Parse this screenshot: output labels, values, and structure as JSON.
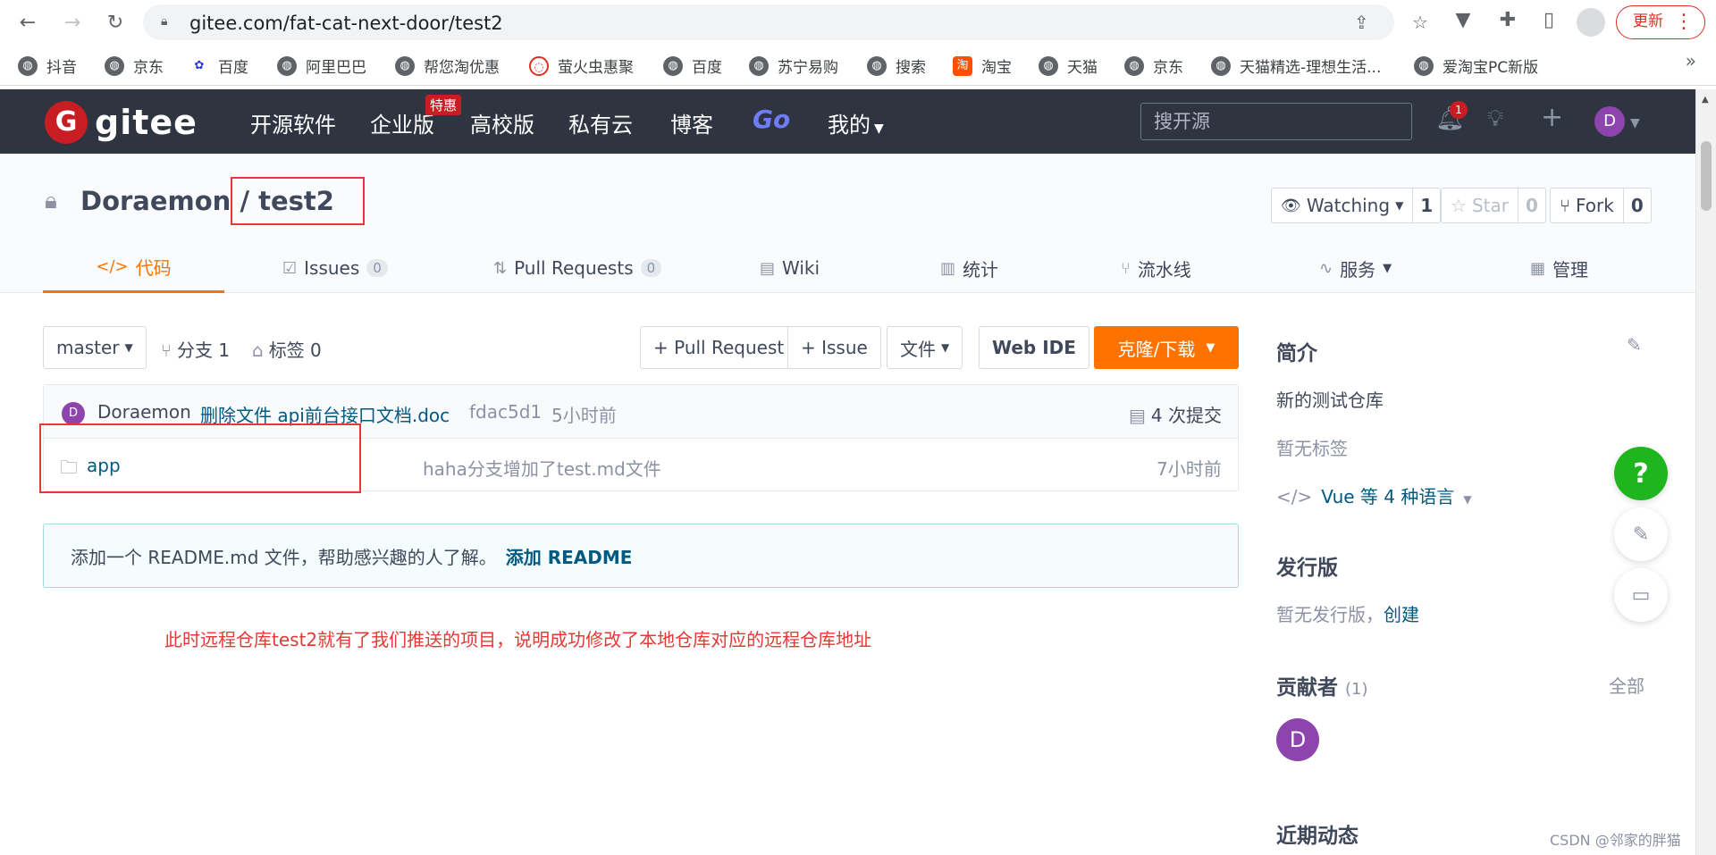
{
  "browser": {
    "url": "gitee.com/fat-cat-next-door/test2",
    "update_label": "更新",
    "bookmarks": [
      "抖音",
      "京东",
      "百度",
      "阿里巴巴",
      "帮您淘优惠",
      "萤火虫惠聚",
      "百度",
      "苏宁易购",
      "搜索",
      "淘宝",
      "天猫",
      "京东",
      "天猫精选-理想生活...",
      "爱淘宝PC新版"
    ],
    "more": "»"
  },
  "gitee_nav": {
    "logo_text": "gitee",
    "items": [
      "开源软件",
      "企业版",
      "高校版",
      "私有云",
      "博客",
      "Go",
      "我的"
    ],
    "enterprise_badge": "特惠",
    "search_placeholder": "搜开源",
    "notification_count": "1",
    "user_initial": "D"
  },
  "repo": {
    "owner": "Doraemon",
    "separator": "/",
    "name": "test2",
    "watching_label": "Watching",
    "watching_count": "1",
    "star_label": "Star",
    "star_count": "0",
    "fork_label": "Fork",
    "fork_count": "0",
    "tabs": [
      {
        "label": "代码"
      },
      {
        "label": "Issues",
        "count": "0"
      },
      {
        "label": "Pull Requests",
        "count": "0"
      },
      {
        "label": "Wiki"
      },
      {
        "label": "统计"
      },
      {
        "label": "流水线"
      },
      {
        "label": "服务"
      },
      {
        "label": "管理"
      }
    ]
  },
  "toolbar": {
    "branch": "master",
    "branches": "分支 1",
    "tags": "标签 0",
    "pull_request": "+ Pull Request",
    "issue": "+ Issue",
    "file": "文件",
    "web_ide": "Web IDE",
    "clone": "克隆/下载"
  },
  "commit": {
    "avatar_initial": "D",
    "author": "Doraemon",
    "message": "删除文件 api前台接口文档.doc",
    "hash": "fdac5d1",
    "time": "5小时前",
    "count_label": "4 次提交"
  },
  "files": [
    {
      "name": "app",
      "message": "haha分支增加了test.md文件",
      "time": "7小时前"
    }
  ],
  "readme_notice": {
    "text": "添加一个 README.md 文件，帮助感兴趣的人了解。",
    "link": "添加 README"
  },
  "annotation": "此时远程仓库test2就有了我们推送的项目，说明成功修改了本地仓库对应的远程仓库地址",
  "sidebar": {
    "intro_title": "简介",
    "description": "新的测试仓库",
    "no_tags": "暂无标签",
    "languages": "Vue 等 4 种语言",
    "release_title": "发行版",
    "no_release": "暂无发行版，",
    "create_link": "创建",
    "contributors_title": "贡献者",
    "contributors_count": "(1)",
    "all_link": "全部",
    "contributor_initial": "D",
    "recent_title": "近期动态"
  },
  "watermark": "CSDN @邻家的胖猫"
}
